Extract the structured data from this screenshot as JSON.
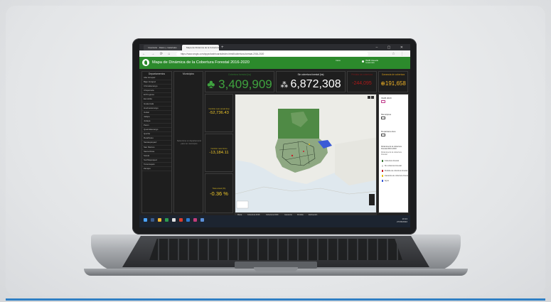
{
  "browser": {
    "tabs": [
      "Inventario · Datos y materiales",
      "Mapa de Dinámica de la Cobertura..."
    ],
    "new_tab": "+",
    "window_controls": "– ▢ ✕",
    "nav_icons": "← → ⟳ ⌂",
    "url": "https://www.arcgis.com/apps/dashboards/index.html#/cobertura-forestal-2016-2020",
    "address_icons": "☆ ⋮"
  },
  "header": {
    "title": "Mapa de Dinámica de la Cobertura Forestal 2016-2020",
    "center_small": "Inicio",
    "user_name": "INAB Usuario",
    "user_sub": "Guatemala",
    "accent": "#2c8a2c"
  },
  "departments": {
    "title": "Departamentos",
    "items": [
      "Alta Verapaz",
      "Baja Verapaz",
      "Chimaltenango",
      "Chiquimula",
      "El Progreso",
      "Escuintla",
      "Guatemala",
      "Huehuetenango",
      "Izabal",
      "Jalapa",
      "Jutiapa",
      "Petén",
      "Quetzaltenango",
      "Quiché",
      "Retalhuleu",
      "Sacatepéquez",
      "San Marcos",
      "Santa Rosa",
      "Sololá",
      "Suchitepéquez",
      "Totonicapán",
      "Zacapa"
    ]
  },
  "municipalities": {
    "title": "Municipios",
    "empty_message": "Seleccione un departamento para ver municipios"
  },
  "indicators": {
    "forest": {
      "label": "Cobertura forestal (ha)",
      "value": "3,409,909",
      "color": "#3fa33f"
    },
    "nonforest": {
      "label": "Sin cobertura forestal (ha)",
      "value": "6,872,308",
      "color": "#ffffff"
    },
    "loss": {
      "label": "Pérdida de cobertura",
      "value": "-244,095",
      "color": "#b01818"
    },
    "gain": {
      "label": "Ganancia de cobertura",
      "value": "191,658",
      "color": "#f0b226"
    }
  },
  "side_stats": [
    {
      "label": "Cambio neto anual (ha)",
      "value": "-52,736.43"
    },
    {
      "label": "Cambio neto bruto",
      "value": "-13,184.11"
    },
    {
      "label": "Tasa anual (%)",
      "value": "-0.36 %"
    }
  ],
  "map": {
    "tabs": [
      "Mapa",
      "Cobertura 2016",
      "Cobertura 2020",
      "Ganancia",
      "Pérdida",
      "Estimación"
    ],
    "colors": {
      "forest": "#3f7a3a",
      "loss": "#c8202a",
      "gain": "#e8c21e",
      "water": "#bcd3e6",
      "land": "#e9e9e4"
    }
  },
  "right_panel": {
    "layer_title": "INAB 2020",
    "municipios_title": "Municipios",
    "departamentos_title": "Departamentos",
    "legend_title": "Dinámica de la cobertura forestal 2016-2020",
    "legend_sub": "Dinámica de la cobertura forestal",
    "legend": [
      {
        "label": "Cobertura forestal",
        "color": "#3f7a3a"
      },
      {
        "label": "Sin cobertura forestal",
        "color": "#d8d8d8"
      },
      {
        "label": "Pérdida de cobertura forestal",
        "color": "#c8202a"
      },
      {
        "label": "Ganancia de cobertura forestal",
        "color": "#e8c21e"
      },
      {
        "label": "Agua",
        "color": "#3b5bd6"
      }
    ]
  },
  "taskbar": {
    "time": "10:24",
    "date": "27/06/2022"
  }
}
